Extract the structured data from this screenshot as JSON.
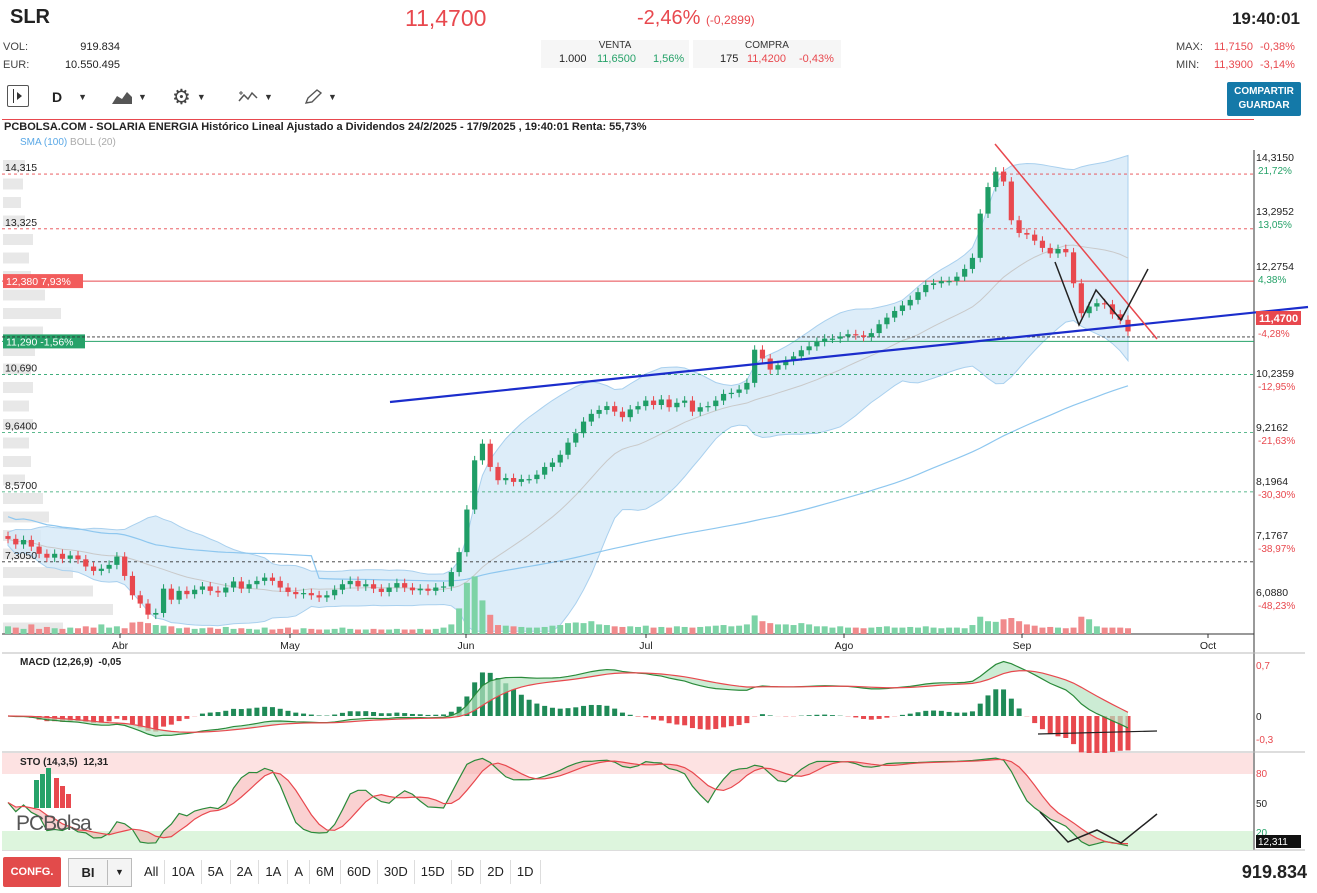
{
  "header": {
    "ticker": "SLR",
    "price": "11,4700",
    "change_pct": "-2,46%",
    "change_abs": "(-0,2899)",
    "time": "19:40:01",
    "vol_label": "VOL:",
    "vol_value": "919.834",
    "eur_label": "EUR:",
    "eur_value": "10.550.495",
    "venta": {
      "label": "VENTA",
      "qty": "1.000",
      "price": "11,6500",
      "pct": "1,56%"
    },
    "compra": {
      "label": "COMPRA",
      "qty": "175",
      "price": "11,4200",
      "pct": "-0,43%"
    },
    "max_label": "MAX:",
    "max_price": "11,7150",
    "max_pct": "-0,38%",
    "min_label": "MIN:",
    "min_price": "11,3900",
    "min_pct": "-3,14%"
  },
  "toolbar": {
    "period": "D",
    "share_line1": "COMPARTIR",
    "share_line2": "GUARDAR",
    "icons": [
      "panel-toggle-icon",
      "period-caret-icon",
      "chart-type-icon",
      "settings-gear-icon",
      "indicators-icon",
      "drawing-pencil-icon"
    ]
  },
  "chart_data": [
    {
      "type": "candlestick",
      "title": "PCBOLSA.COM - SOLARIA ENERGIA Histórico Lineal Ajustado a Dividendos 24/2/2025 - 17/9/2025 , 19:40:01 Renta: 55,73%",
      "legend": [
        "SMA (100)",
        "BOLL (20)"
      ],
      "x_labels": [
        "Abr",
        "May",
        "Jun",
        "Jul",
        "Ago",
        "Sep",
        "Oct"
      ],
      "y_axis": [
        {
          "value": "14,3150",
          "pct": "21,72%"
        },
        {
          "value": "13,2952",
          "pct": "13,05%"
        },
        {
          "value": "12,2754",
          "pct": "4,38%"
        },
        {
          "value": "11,4700",
          "pct": "-4,28%"
        },
        {
          "value": "10,2359",
          "pct": "-12,95%"
        },
        {
          "value": "9,2162",
          "pct": "-21,63%"
        },
        {
          "value": "8,1964",
          "pct": "-30,30%"
        },
        {
          "value": "7,1767",
          "pct": "-38,97%"
        },
        {
          "value": "6,0880",
          "pct": "-48,23%"
        }
      ],
      "levels": [
        {
          "value": 14.315,
          "label": "14,315"
        },
        {
          "value": 13.325,
          "label": "13,325"
        },
        {
          "value": 12.38,
          "label": "12,380",
          "pct": "7,93%"
        },
        {
          "value": 11.29,
          "label": "11,290",
          "pct": "-1,56%"
        },
        {
          "value": 10.69,
          "label": "10,690"
        },
        {
          "value": 9.64,
          "label": "9,6400"
        },
        {
          "value": 8.57,
          "label": "8,5700"
        },
        {
          "value": 7.305,
          "label": "7,3050"
        }
      ],
      "ylim": [
        6.0,
        14.75
      ],
      "closes": [
        7.72,
        7.62,
        7.7,
        7.58,
        7.45,
        7.38,
        7.45,
        7.36,
        7.42,
        7.35,
        7.22,
        7.14,
        7.18,
        7.25,
        7.4,
        7.05,
        6.7,
        6.55,
        6.35,
        6.38,
        6.82,
        6.62,
        6.78,
        6.72,
        6.8,
        6.86,
        6.78,
        6.75,
        6.84,
        6.95,
        6.82,
        6.9,
        6.96,
        7.02,
        6.96,
        6.84,
        6.76,
        6.72,
        6.74,
        6.7,
        6.66,
        6.7,
        6.8,
        6.9,
        6.96,
        6.86,
        6.9,
        6.82,
        6.76,
        6.84,
        6.92,
        6.84,
        6.79,
        6.82,
        6.78,
        6.84,
        6.86,
        7.12,
        7.48,
        8.25,
        9.14,
        9.44,
        9.02,
        8.78,
        8.82,
        8.75,
        8.8,
        8.8,
        8.88,
        9.02,
        9.1,
        9.24,
        9.46,
        9.63,
        9.84,
        9.98,
        10.05,
        10.12,
        10.02,
        9.92,
        10.06,
        10.12,
        10.22,
        10.14,
        10.24,
        10.1,
        10.18,
        10.22,
        10.02,
        10.1,
        10.12,
        10.22,
        10.34,
        10.36,
        10.42,
        10.54,
        11.14,
        10.98,
        10.78,
        10.86,
        10.94,
        11.02,
        11.13,
        11.2,
        11.28,
        11.34,
        11.34,
        11.38,
        11.42,
        11.4,
        11.37,
        11.44,
        11.6,
        11.72,
        11.84,
        11.94,
        12.04,
        12.18,
        12.31,
        12.34,
        12.38,
        12.38,
        12.46,
        12.6,
        12.8,
        13.6,
        14.08,
        14.36,
        14.18,
        13.48,
        13.25,
        13.22,
        13.11,
        12.98,
        12.88,
        12.96,
        12.9,
        12.34,
        11.8,
        11.92,
        11.98,
        11.96,
        11.78,
        11.68,
        11.47
      ],
      "volumes": [
        0.24,
        0.2,
        0.16,
        0.3,
        0.16,
        0.22,
        0.18,
        0.16,
        0.2,
        0.18,
        0.24,
        0.2,
        0.3,
        0.2,
        0.24,
        0.18,
        0.36,
        0.38,
        0.34,
        0.28,
        0.26,
        0.24,
        0.18,
        0.2,
        0.16,
        0.18,
        0.2,
        0.16,
        0.22,
        0.16,
        0.18,
        0.16,
        0.14,
        0.2,
        0.14,
        0.16,
        0.2,
        0.14,
        0.18,
        0.16,
        0.14,
        0.14,
        0.16,
        0.2,
        0.16,
        0.14,
        0.14,
        0.16,
        0.14,
        0.14,
        0.16,
        0.14,
        0.14,
        0.16,
        0.14,
        0.16,
        0.2,
        0.3,
        0.8,
        1.6,
        1.8,
        1.05,
        0.6,
        0.28,
        0.26,
        0.24,
        0.22,
        0.2,
        0.2,
        0.22,
        0.26,
        0.28,
        0.34,
        0.36,
        0.34,
        0.4,
        0.3,
        0.28,
        0.24,
        0.22,
        0.24,
        0.22,
        0.26,
        0.2,
        0.22,
        0.2,
        0.24,
        0.22,
        0.2,
        0.22,
        0.24,
        0.26,
        0.28,
        0.24,
        0.26,
        0.3,
        0.58,
        0.4,
        0.34,
        0.3,
        0.3,
        0.28,
        0.34,
        0.3,
        0.24,
        0.24,
        0.2,
        0.24,
        0.2,
        0.2,
        0.18,
        0.2,
        0.22,
        0.24,
        0.2,
        0.2,
        0.22,
        0.2,
        0.24,
        0.2,
        0.18,
        0.2,
        0.2,
        0.18,
        0.28,
        0.54,
        0.4,
        0.38,
        0.46,
        0.5,
        0.4,
        0.3,
        0.26,
        0.2,
        0.22,
        0.2,
        0.18,
        0.2,
        0.54,
        0.46,
        0.24,
        0.2,
        0.2,
        0.2,
        0.18
      ],
      "current_price": 11.47
    },
    {
      "type": "line",
      "name": "MACD (12,26,9)",
      "value": "-0,05",
      "y_ticks": [
        "0,7",
        "0",
        "-0,3"
      ]
    },
    {
      "type": "line",
      "name": "STO (14,3,5)",
      "value": "12,31",
      "y_ticks": [
        "80",
        "50",
        "20"
      ],
      "current": "12,311"
    }
  ],
  "bottom": {
    "config": "CONFG.",
    "type": "BI",
    "ranges": [
      "All",
      "10A",
      "5A",
      "2A",
      "1A",
      "A",
      "6M",
      "60D",
      "30D",
      "15D",
      "5D",
      "2D",
      "1D"
    ],
    "total_volume": "919.834",
    "logo": "PCBolsa"
  }
}
